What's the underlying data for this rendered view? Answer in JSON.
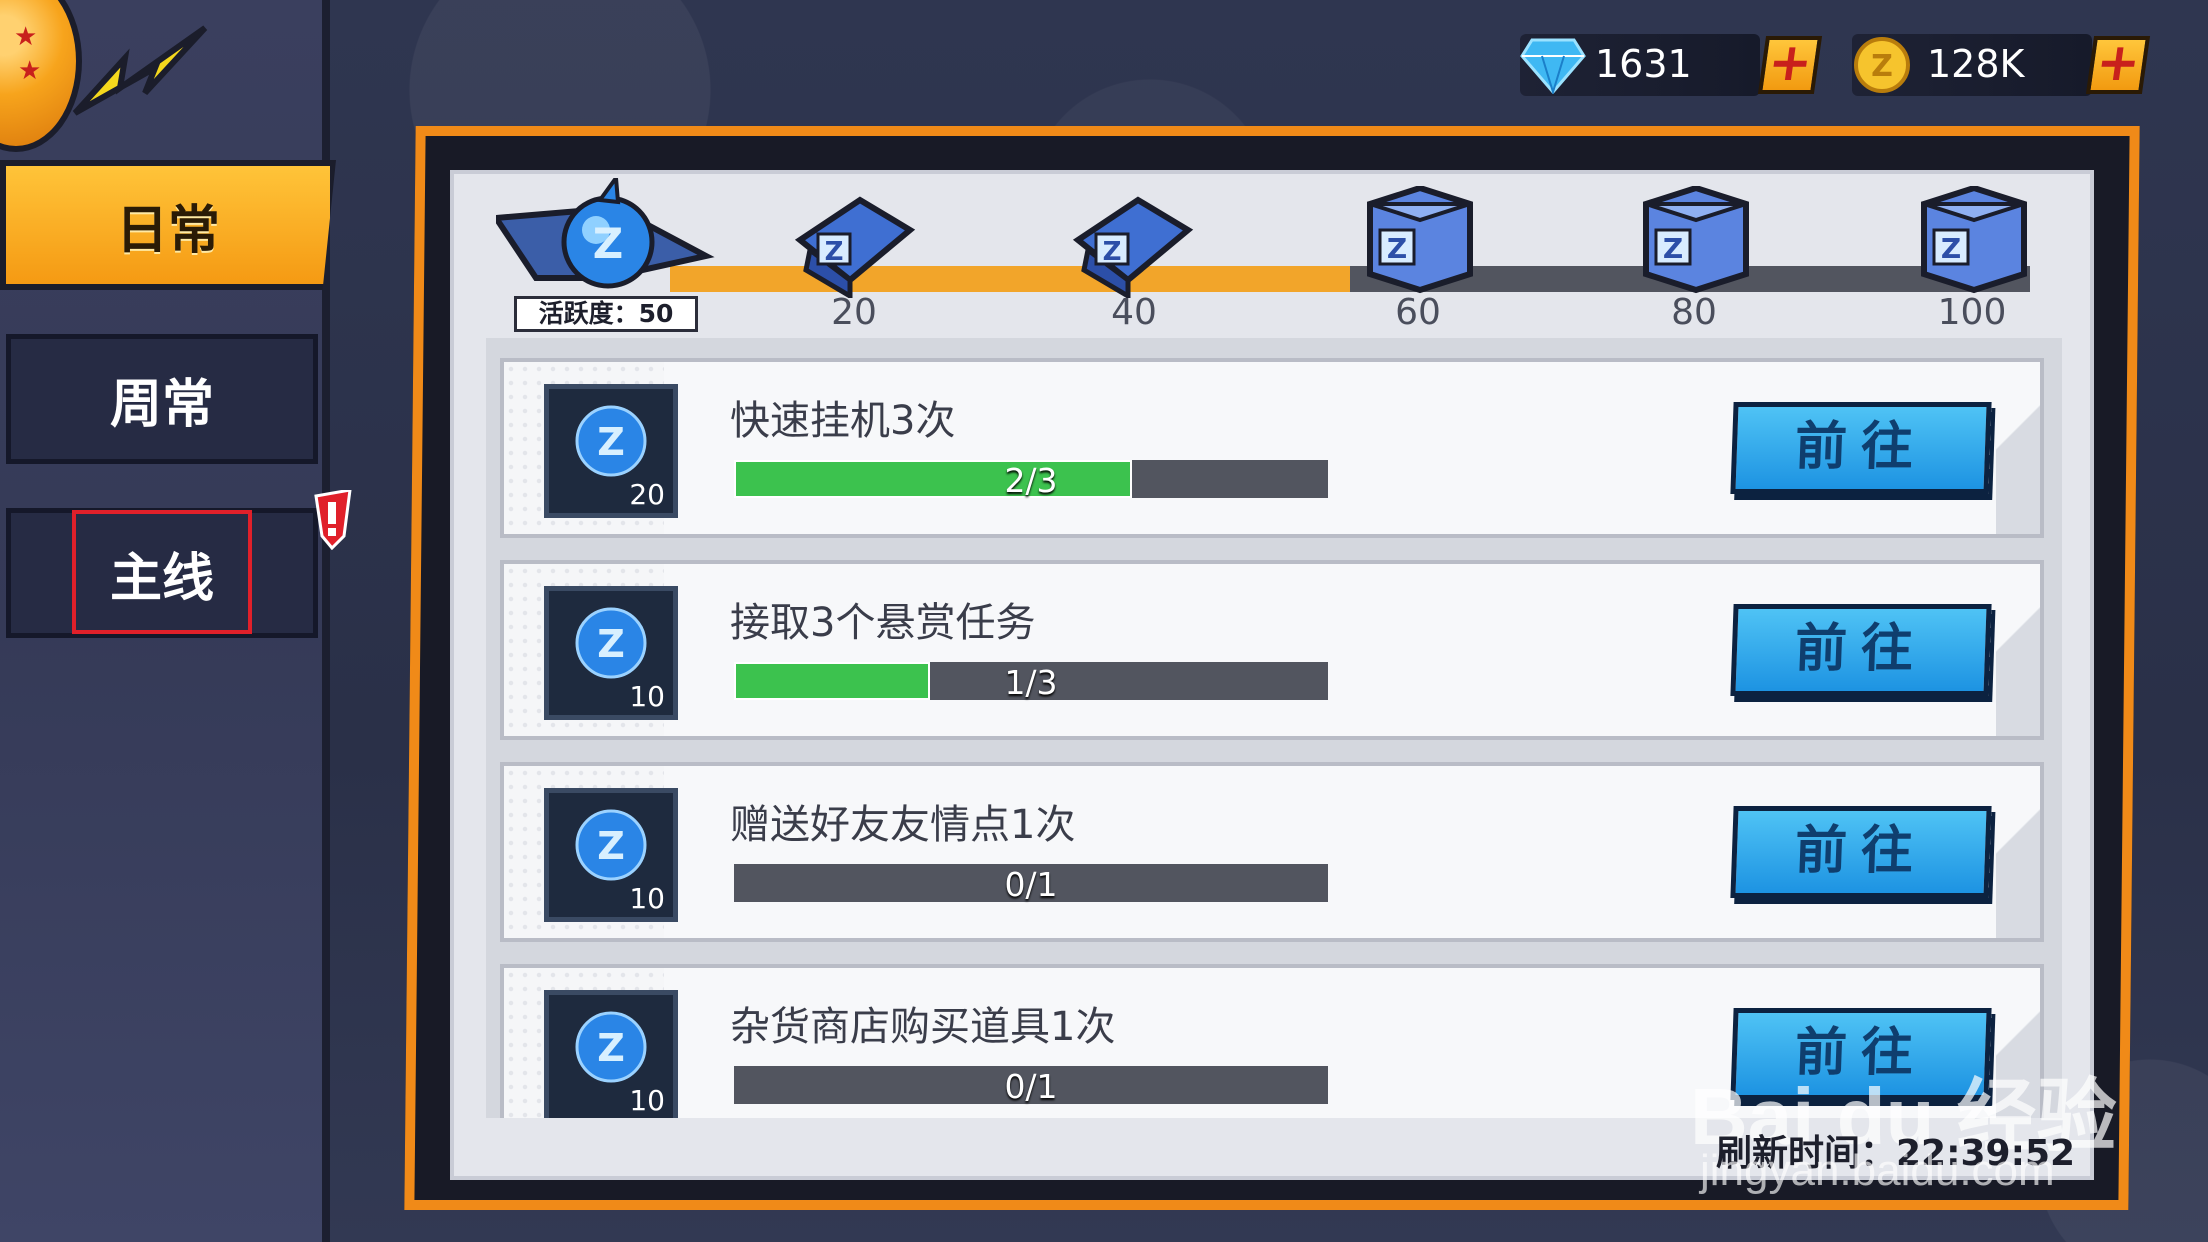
{
  "currency": {
    "gems": "1631",
    "coins": "128K",
    "plus_label": "+"
  },
  "sidebar": {
    "tabs": [
      {
        "label": "日常"
      },
      {
        "label": "周常"
      },
      {
        "label": "主线"
      }
    ]
  },
  "activity": {
    "label": "活跃度：50",
    "current": 50,
    "max": 100,
    "milestones": [
      "20",
      "40",
      "60",
      "80",
      "100"
    ]
  },
  "quests": [
    {
      "title": "快速挂机3次",
      "reward": "20",
      "progress_text": "2/3",
      "progress": 0.67,
      "button": "前往"
    },
    {
      "title": "接取3个悬赏任务",
      "reward": "10",
      "progress_text": "1/3",
      "progress": 0.33,
      "button": "前往"
    },
    {
      "title": "赠送好友友情点1次",
      "reward": "10",
      "progress_text": "0/1",
      "progress": 0,
      "button": "前往"
    },
    {
      "title": "杂货商店购买道具1次",
      "reward": "10",
      "progress_text": "0/1",
      "progress": 0,
      "button": "前往"
    }
  ],
  "refresh_time": "刷新时间：22:39:52",
  "watermark": {
    "brand": "Bai du 经验",
    "site": "jingyan.baidu.com"
  },
  "colors": {
    "accent_orange": "#f08a18",
    "progress_green": "#3cc24e",
    "button_blue": "#1d93e2"
  }
}
